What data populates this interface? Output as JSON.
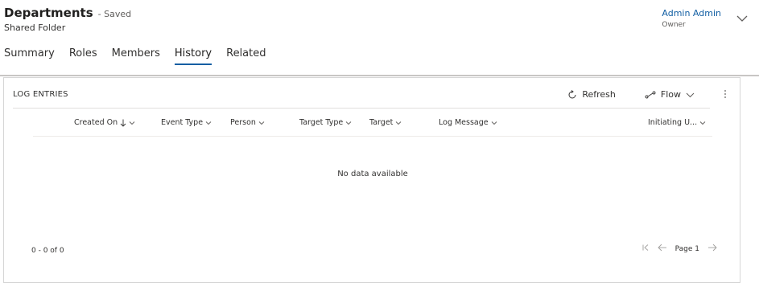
{
  "header": {
    "title": "Departments",
    "saved_status": "- Saved",
    "subtitle": "Shared Folder",
    "owner_name": "Admin Admin",
    "owner_role": "Owner"
  },
  "tabs": [
    {
      "label": "Summary",
      "active": false
    },
    {
      "label": "Roles",
      "active": false
    },
    {
      "label": "Members",
      "active": false
    },
    {
      "label": "History",
      "active": true
    },
    {
      "label": "Related",
      "active": false
    }
  ],
  "log": {
    "title": "LOG ENTRIES",
    "toolbar": {
      "refresh_label": "Refresh",
      "flow_label": "Flow",
      "refresh_icon": "refresh-icon",
      "flow_icon": "flow-icon",
      "more_icon": "more-vertical-icon"
    },
    "columns": [
      {
        "label": "Created On",
        "sorted": "descending"
      },
      {
        "label": "Event Type"
      },
      {
        "label": "Person"
      },
      {
        "label": "Target Type"
      },
      {
        "label": "Target"
      },
      {
        "label": "Log Message"
      },
      {
        "label": "Initiating U..."
      }
    ],
    "empty_message": "No data available",
    "record_count": "0 - 0 of 0",
    "page_label": "Page 1"
  },
  "colors": {
    "accent": "#115ea3",
    "border": "#d6d6d6",
    "divider": "#c8c6c4"
  }
}
